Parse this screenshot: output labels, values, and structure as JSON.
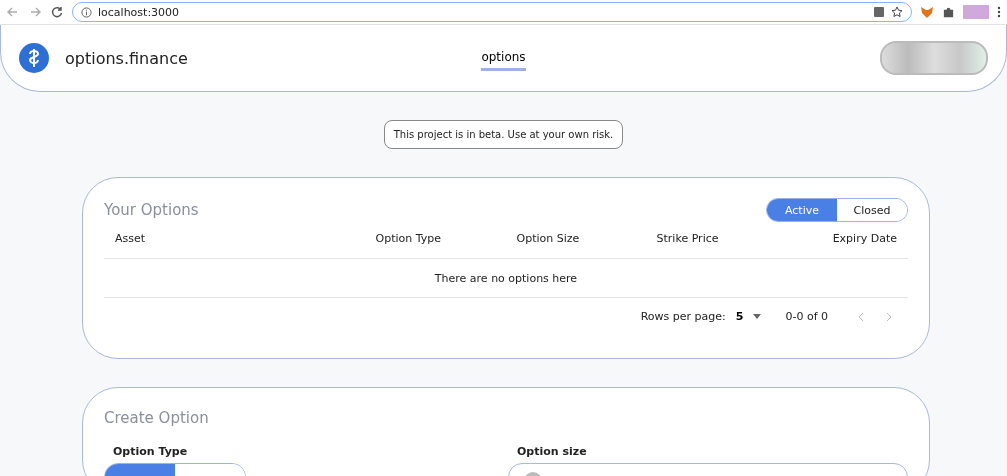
{
  "browser": {
    "url": "localhost:3000"
  },
  "header": {
    "brand": "options.finance",
    "nav": [
      {
        "label": "options",
        "selected": true
      }
    ]
  },
  "notice": "This project is in beta. Use at your own risk.",
  "your_options": {
    "title": "Your Options",
    "filters": [
      {
        "label": "Active",
        "selected": true
      },
      {
        "label": "Closed",
        "selected": false
      }
    ],
    "columns": [
      "Asset",
      "Option Type",
      "Option Size",
      "Strike Price",
      "Expiry Date"
    ],
    "empty_message": "There are no options here",
    "pagination": {
      "rows_label": "Rows per page:",
      "rows_value": "5",
      "range": "0-0 of 0"
    }
  },
  "create_option": {
    "title": "Create Option",
    "option_type_label": "Option Type",
    "option_type_toggle": [
      {
        "selected": true
      },
      {
        "selected": false
      }
    ],
    "option_size_label": "Option size"
  }
}
